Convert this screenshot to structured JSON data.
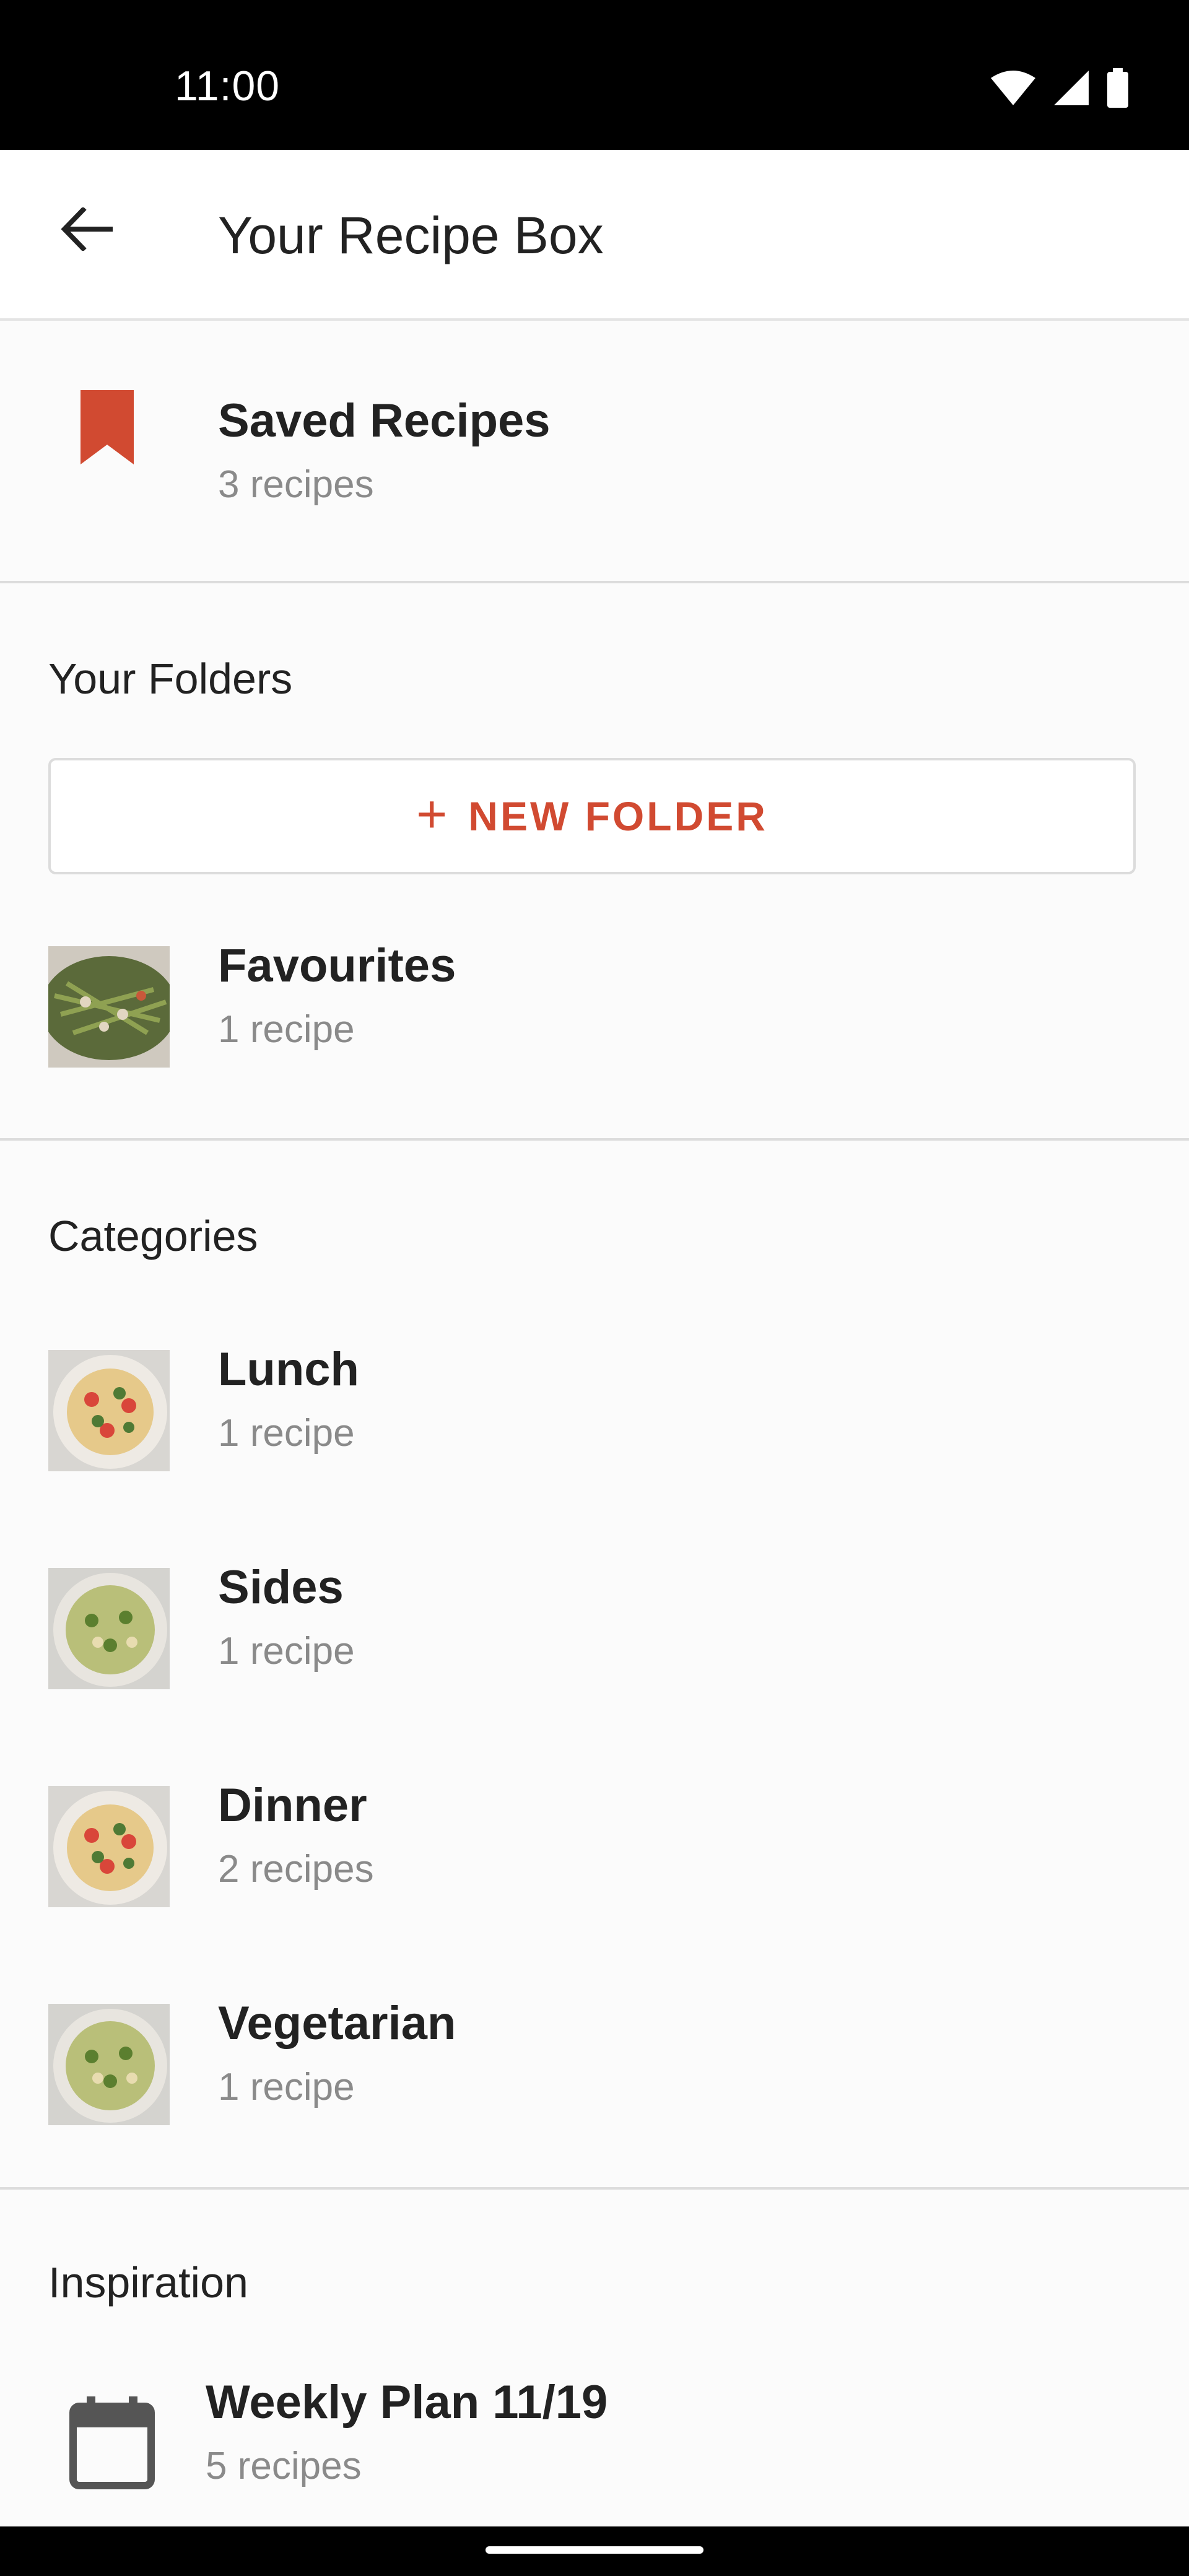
{
  "status_bar": {
    "time": "11:00",
    "icons": [
      "wifi-icon",
      "signal-icon",
      "battery-icon"
    ]
  },
  "app_bar": {
    "back_icon": "arrow-left-icon",
    "title": "Your Recipe Box"
  },
  "saved": {
    "icon": "bookmark-icon",
    "title": "Saved Recipes",
    "count": "3 recipes"
  },
  "folders": {
    "heading": "Your Folders",
    "new_folder_label": "NEW FOLDER",
    "items": [
      {
        "title": "Favourites",
        "count": "1 recipe"
      }
    ]
  },
  "categories": {
    "heading": "Categories",
    "items": [
      {
        "title": "Lunch",
        "count": "1 recipe"
      },
      {
        "title": "Sides",
        "count": "1 recipe"
      },
      {
        "title": "Dinner",
        "count": "2 recipes"
      },
      {
        "title": "Vegetarian",
        "count": "1 recipe"
      }
    ]
  },
  "inspiration": {
    "heading": "Inspiration",
    "items": [
      {
        "title": "Weekly Plan 11/19",
        "count": "5 recipes",
        "icon": "calendar-icon"
      }
    ]
  },
  "colors": {
    "accent": "#d14a31",
    "status_bar": "#000000",
    "background": "#fbfbfb"
  }
}
